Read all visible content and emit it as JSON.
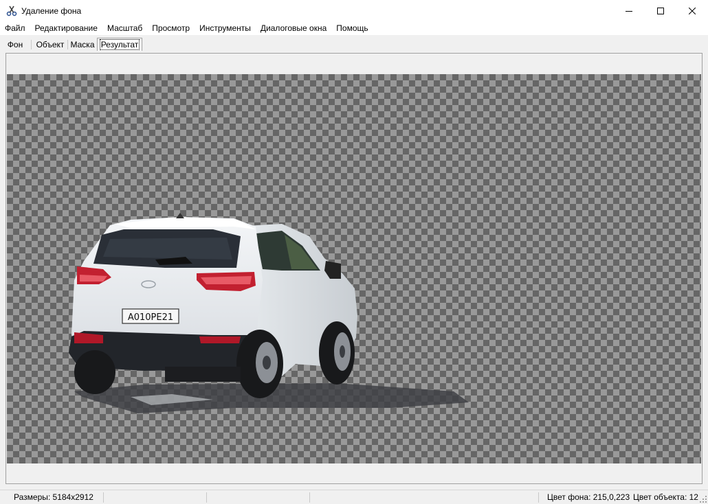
{
  "window": {
    "title": "Удаление фона",
    "app_icon": "scissors-icon",
    "controls": [
      "minimize-icon",
      "maximize-icon",
      "close-icon"
    ]
  },
  "menu": {
    "items": [
      "Файл",
      "Редактирование",
      "Масштаб",
      "Просмотр",
      "Инструменты",
      "Диалоговые окна",
      "Помощь"
    ]
  },
  "tabs": {
    "items": [
      "Фон",
      "Объект",
      "Маска",
      "Результат"
    ],
    "active": "Результат"
  },
  "canvas": {
    "background": "transparency-checkerboard",
    "checker_colors": [
      "#666666",
      "#999999"
    ],
    "image": {
      "subject": "white SUV, rear view, background removed",
      "license_plate": "А010РЕ21"
    }
  },
  "status": {
    "size": "Размеры: 5184x2912",
    "bg_color": "Цвет фона: 215,0,223",
    "obj_color": "Цвет объекта: 12"
  }
}
